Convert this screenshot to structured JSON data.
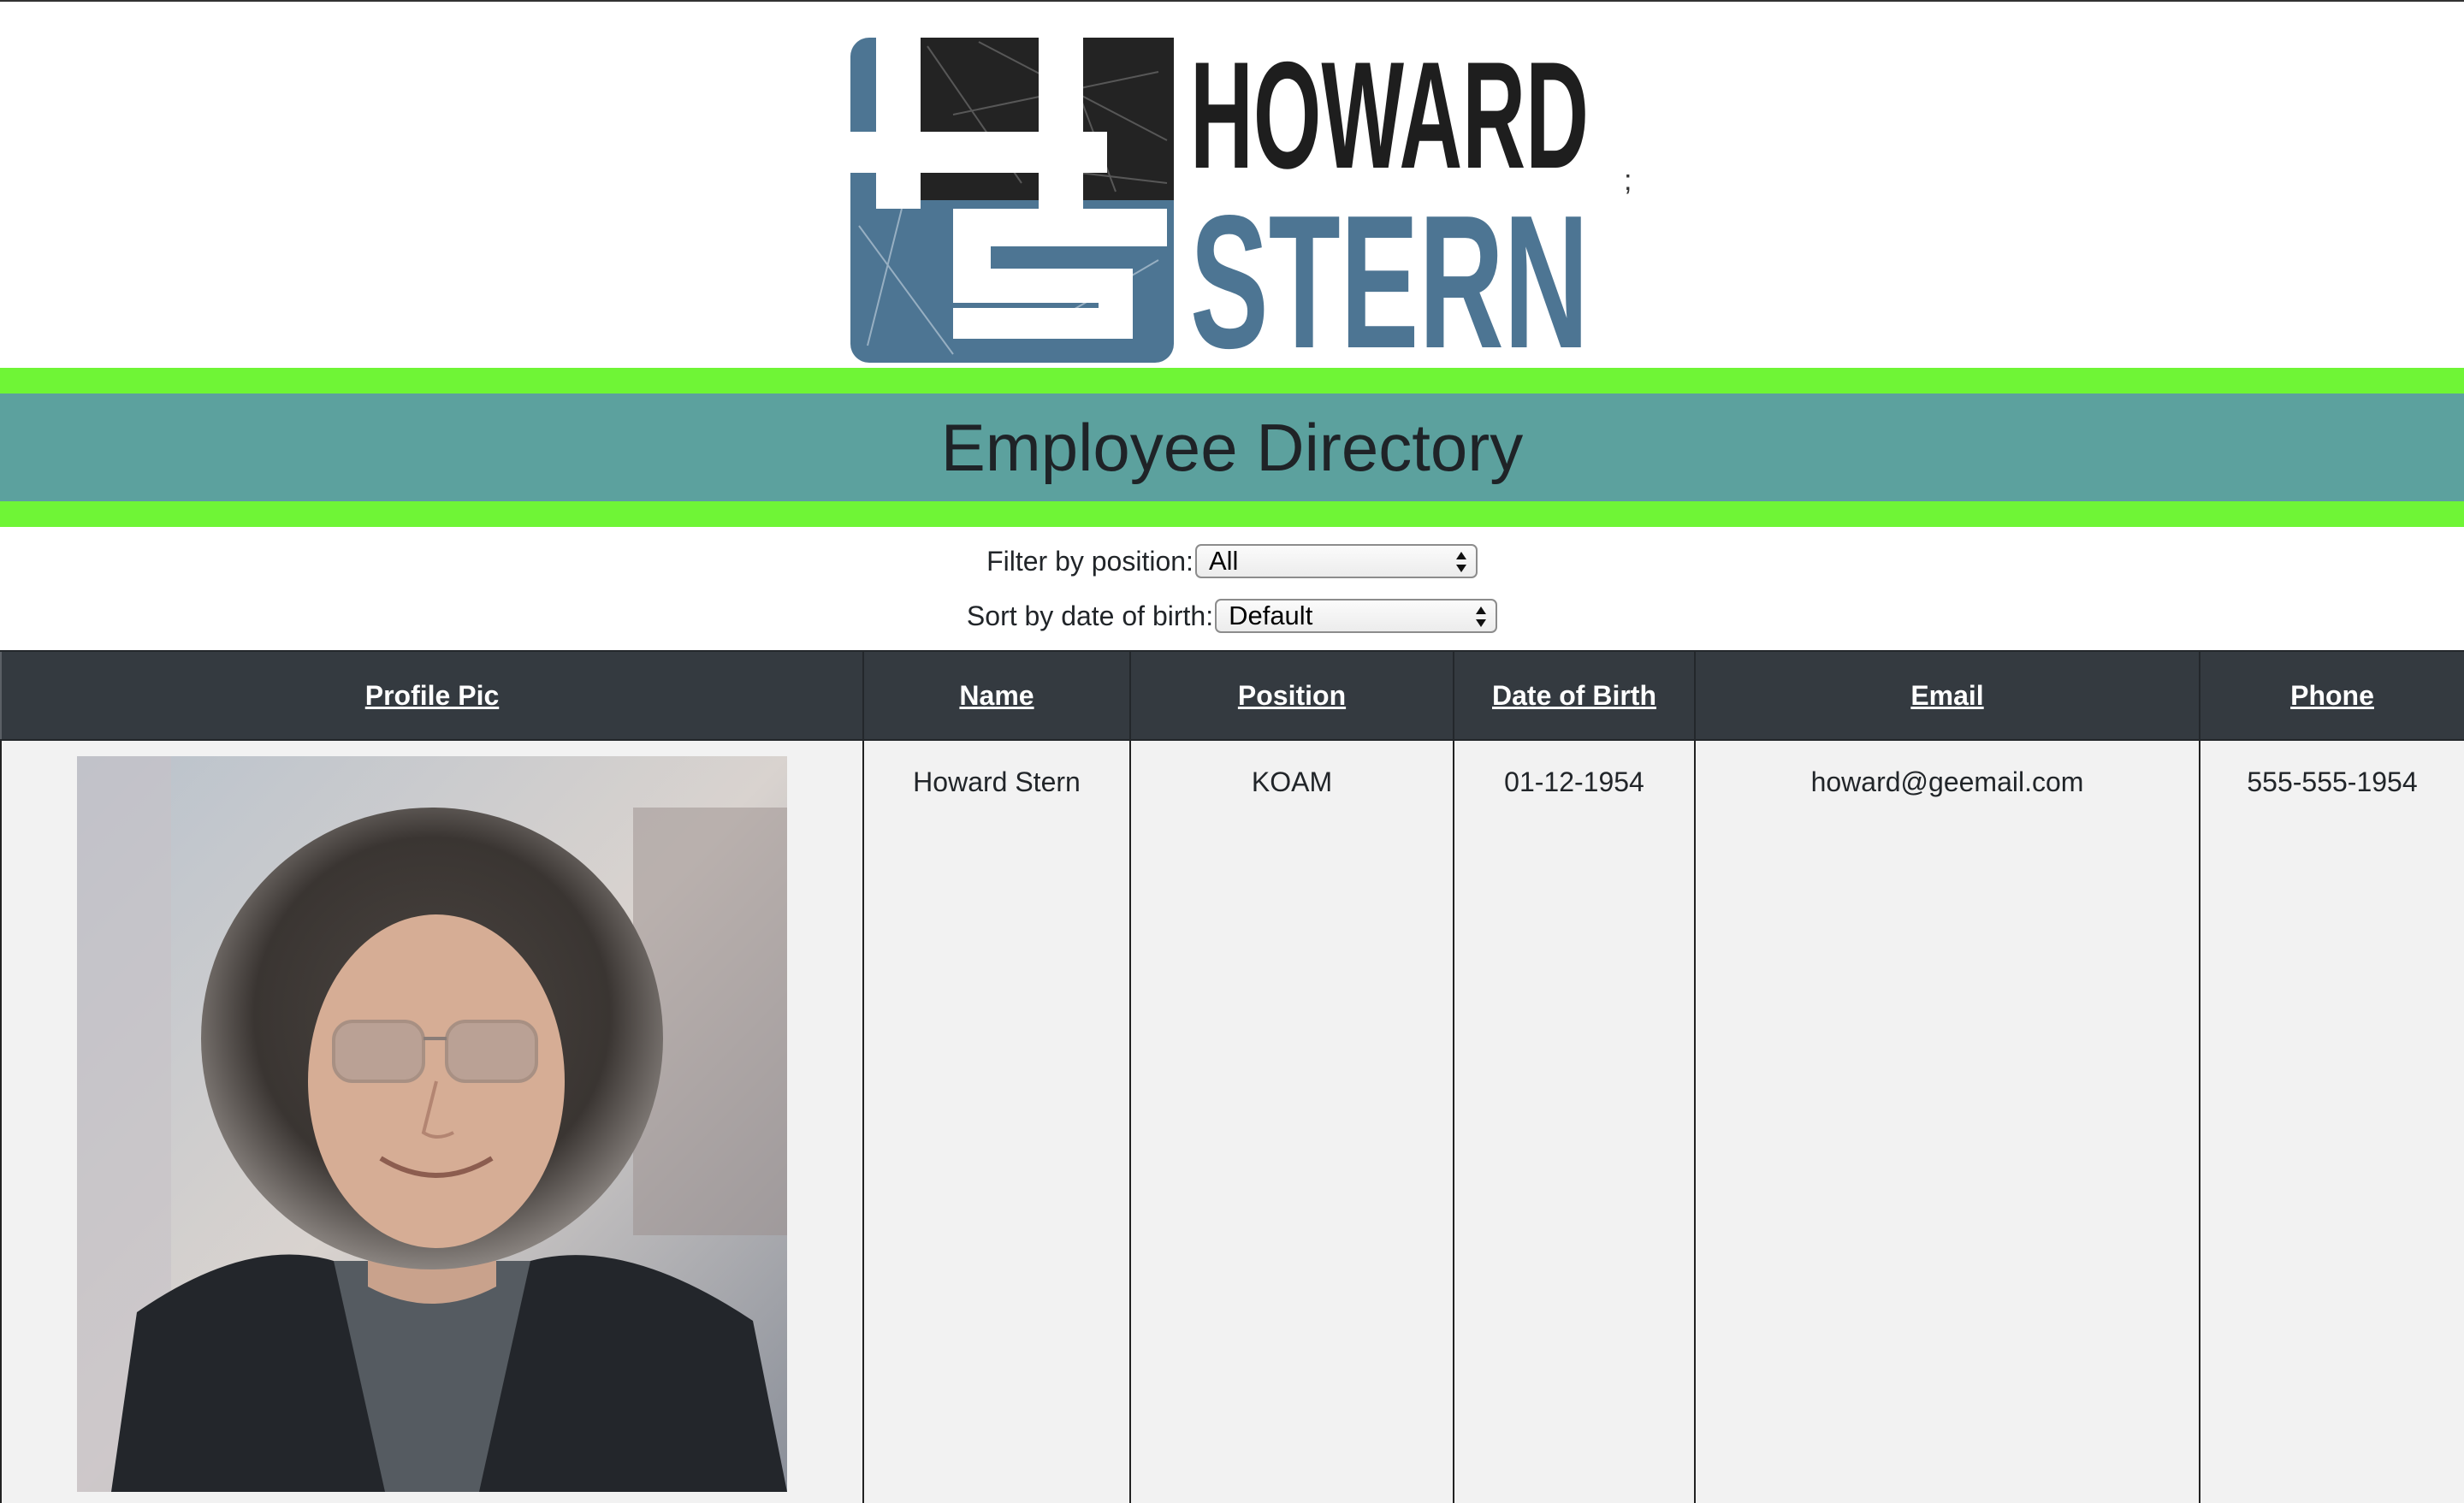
{
  "logo": {
    "line1": "HOWARD",
    "line2": "STERN",
    "suffix": ";"
  },
  "banner": {
    "title": "Employee Directory"
  },
  "controls": {
    "filter_label": "Filter by position:",
    "filter_value": "All",
    "sort_label": "Sort by date of birth:",
    "sort_value": "Default"
  },
  "table": {
    "headers": [
      "Profile Pic",
      "Name",
      "Position",
      "Date of Birth",
      "Email",
      "Phone"
    ],
    "rows": [
      {
        "name": "Howard Stern",
        "position": "KOAM",
        "dob": "01-12-1954",
        "email": "howard@geemail.com",
        "phone": "555-555-1954"
      }
    ]
  },
  "colors": {
    "green_band": "#6ff536",
    "teal_band": "#5ca19e",
    "header_dark": "#343a40",
    "logo_blue": "#4d7593",
    "logo_black": "#1e1e1e"
  }
}
